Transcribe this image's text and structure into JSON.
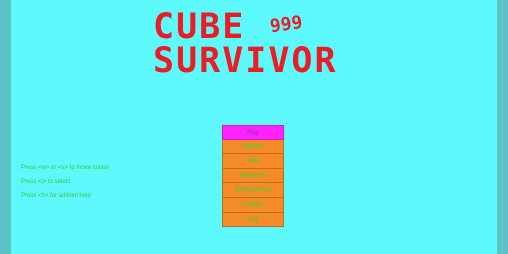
{
  "title": {
    "line1": "CUBE",
    "line2": "SURVIVOR",
    "badge": "999"
  },
  "menu": {
    "items": [
      {
        "label": "Play",
        "selected": true
      },
      {
        "label": "Options",
        "selected": false
      },
      {
        "label": "Help",
        "selected": false
      },
      {
        "label": "Highscore",
        "selected": false
      },
      {
        "label": "Achievements",
        "selected": false
      },
      {
        "label": "Credits",
        "selected": false
      },
      {
        "label": "Quit",
        "selected": false
      }
    ]
  },
  "help": {
    "lines": [
      "Press <w> or <s> to move cursor",
      "Press <j> to select",
      "Press <h> for aditionl help"
    ]
  },
  "colors": {
    "background": "#5ef9fd",
    "edge": "#5dc3c7",
    "title": "#ec1c24",
    "menu_item": "#f58b27",
    "menu_selected": "#ff22ff",
    "menu_text": "#2cd93c",
    "help_text": "#34c934"
  }
}
